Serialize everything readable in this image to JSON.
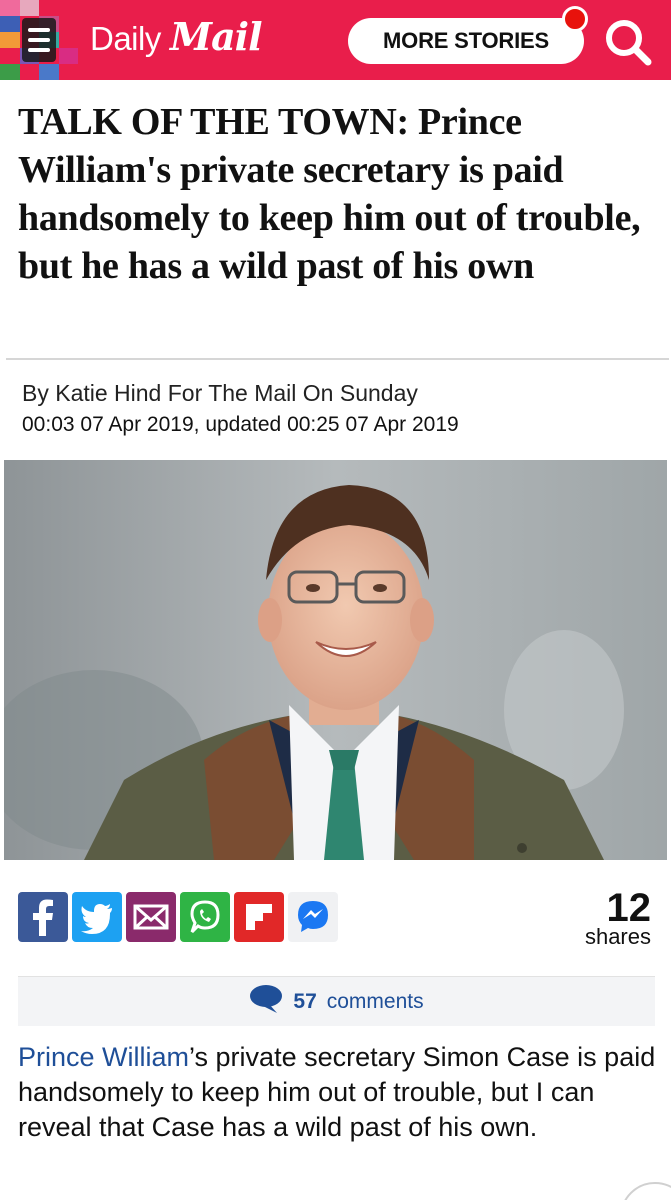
{
  "header": {
    "logo_daily": "Daily",
    "logo_mail": "Mail",
    "more_stories": "MORE STORIES",
    "brand_color": "#e91e4b",
    "menu_icon": "hamburger-menu-icon",
    "search_icon": "search-icon"
  },
  "article": {
    "headline": "TALK OF THE TOWN: Prince William's private secretary is paid handsomely to keep him out of trouble, but he has a wild past of his own",
    "byline": "By Katie Hind For The Mail On Sunday",
    "dateline": "00:03 07 Apr 2019, updated 00:25 07 Apr 2019",
    "body_link": "Prince William",
    "body_rest": "’s private secretary Simon Case is paid handsomely to keep him out of trouble, but I can reveal that Case has a wild past of his own."
  },
  "share": {
    "icons": [
      "facebook-icon",
      "twitter-icon",
      "email-icon",
      "whatsapp-icon",
      "flipboard-icon",
      "messenger-icon"
    ],
    "count": "12",
    "label": "shares"
  },
  "comments": {
    "count": "57",
    "label": "comments",
    "link_color": "#1f4f98"
  }
}
